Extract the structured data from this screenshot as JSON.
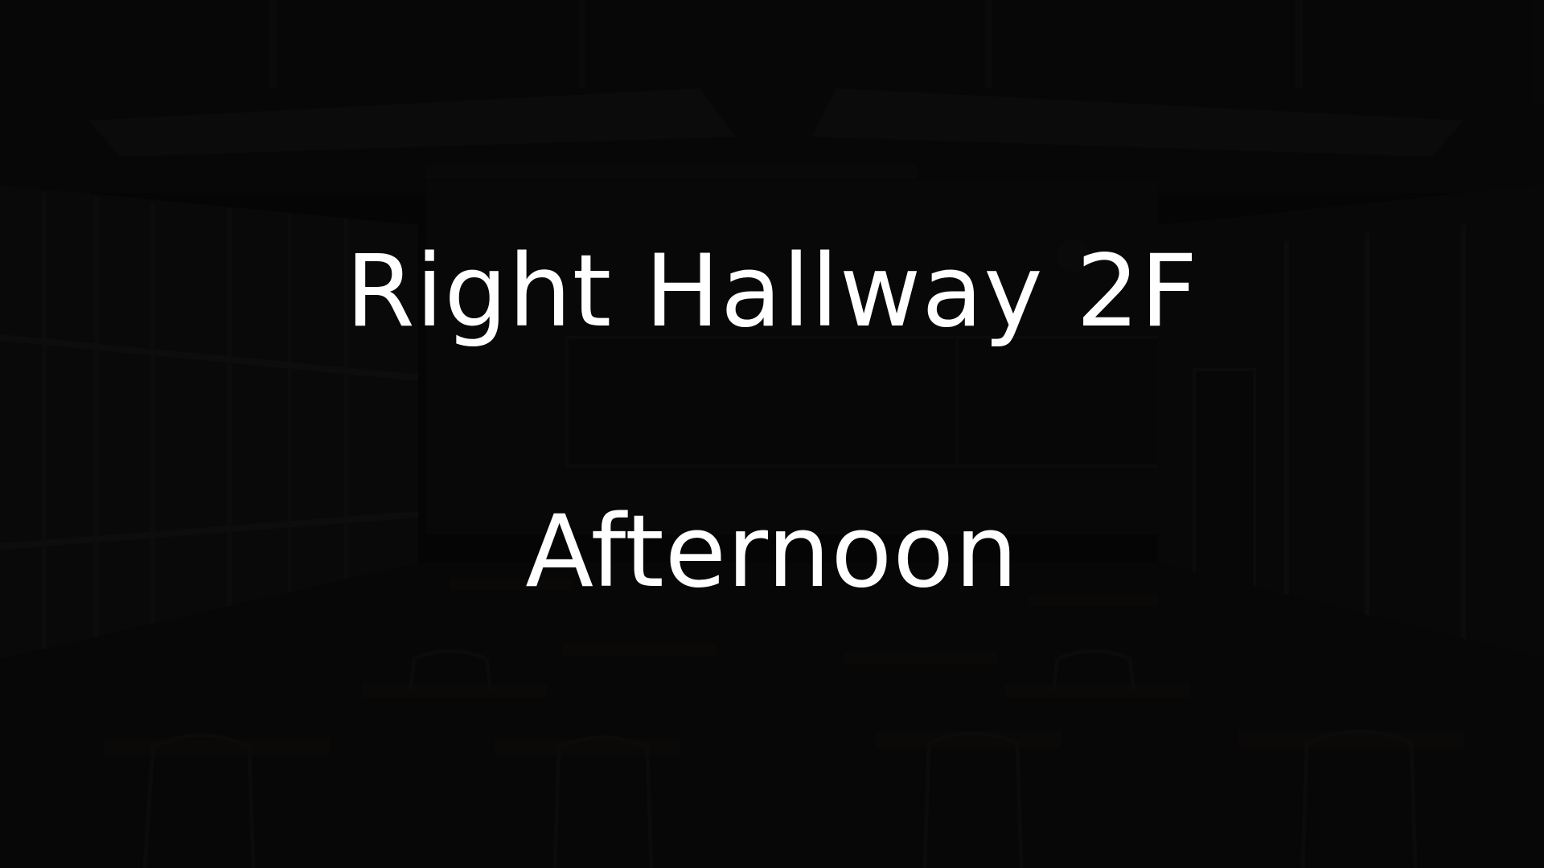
{
  "scene": {
    "background_name": "dark-classroom-background",
    "location_label": "Right Hallway 2F",
    "time_label": "Afternoon",
    "text_color": "#ffffff",
    "overlay_color": "#000000"
  }
}
